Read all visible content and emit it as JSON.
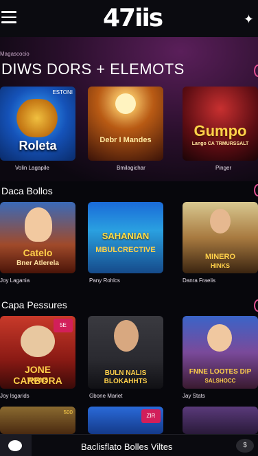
{
  "header": {
    "logo": "47iis",
    "menu_icon": "hamburger-icon",
    "right_icon": "star-sparkle-icon"
  },
  "hero": {
    "tiny_label": "Magascocio",
    "title": "DIWS DORS + ELEMOTS"
  },
  "sections": [
    {
      "title": "",
      "cards": [
        {
          "art_text": "Roleta",
          "badge": "ESTONI",
          "caption": "Volin Lagapile"
        },
        {
          "art_text": "Debr I Mandes",
          "badge": "",
          "caption": "Bmilagichar"
        },
        {
          "art_text": "Gumpo",
          "art_sub": "Lango CA TRMURSSALT",
          "badge": "",
          "caption": "Pinger"
        }
      ]
    },
    {
      "title": "Daca Bollos",
      "cards": [
        {
          "art_text": "Catelo",
          "art_sub": "Bner Atlerela",
          "badge": "",
          "caption": "Joy Lagania"
        },
        {
          "art_text": "SAHANIAN",
          "art_sub": "MBULCRECTIVE",
          "badge": "",
          "caption": "Pany Rohlcs"
        },
        {
          "art_text": "MINERO",
          "art_sub": "HINKS",
          "badge": "",
          "caption": "Danra Fraelis"
        }
      ]
    },
    {
      "title": "Capa Pessures",
      "cards": [
        {
          "art_text": "JONE CARBORA",
          "art_sub": "WOINS",
          "badge": "5E",
          "caption": "Joy Isgarids"
        },
        {
          "art_text": "BULN NALIS",
          "art_sub": "BLOKAHHTS",
          "badge": "",
          "caption": "Gbone Mariet"
        },
        {
          "art_text": "FNNE LOOTES DIP",
          "art_sub": "SALSHOCC",
          "badge": "",
          "caption": "Jay Stats"
        }
      ]
    }
  ],
  "row4": {
    "badge1": "500",
    "badge2": "ZIR"
  },
  "bottom_bar": {
    "label": "Baclisflato Bolles  Viltes",
    "left_icon": "user-icon",
    "right_icon": "coin-icon",
    "right_text": "$"
  }
}
